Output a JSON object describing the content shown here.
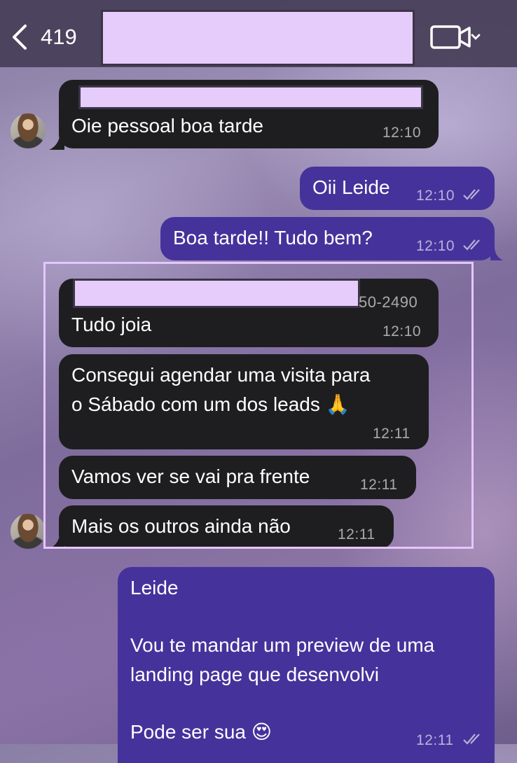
{
  "header": {
    "back_count": "419",
    "video_icon": "video-camera-icon"
  },
  "messages": [
    {
      "id": "m1",
      "direction": "incoming",
      "text": "Oie pessoal boa tarde",
      "time": "12:10"
    },
    {
      "id": "m2",
      "direction": "outgoing",
      "text": "Oii Leide",
      "time": "12:10",
      "status": "read"
    },
    {
      "id": "m3",
      "direction": "outgoing",
      "text": "Boa tarde!! Tudo bem?",
      "time": "12:10",
      "status": "read"
    },
    {
      "id": "m4",
      "direction": "incoming",
      "sender_suffix": "50-2490",
      "text": "Tudo joia",
      "time": "12:10"
    },
    {
      "id": "m5",
      "direction": "incoming",
      "lines": [
        "Consegui agendar uma visita para",
        "o Sábado com um dos leads 🙏"
      ],
      "time": "12:11"
    },
    {
      "id": "m6",
      "direction": "incoming",
      "text": "Vamos ver se vai pra frente",
      "time": "12:11"
    },
    {
      "id": "m7",
      "direction": "incoming",
      "text": "Mais os outros ainda não",
      "time": "12:11"
    },
    {
      "id": "m8",
      "direction": "outgoing",
      "lines": [
        "Leide",
        "",
        "Vou te mandar um preview de uma",
        "landing page que desenvolvi",
        "",
        "Pode ser sua 😍"
      ],
      "time": "12:11",
      "status": "read"
    }
  ]
}
